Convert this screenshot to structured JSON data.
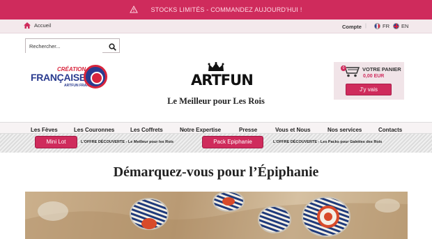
{
  "promo": {
    "icon": "warning-triangle-icon",
    "text": "STOCKS LIMITÉS - COMMANDEZ AUJOURD'HUI !"
  },
  "top_nav": {
    "home_label": "Accueil",
    "account_label": "Compte",
    "languages": [
      {
        "code": "FR"
      },
      {
        "code": "EN"
      }
    ]
  },
  "search": {
    "placeholder": "Rechercher..."
  },
  "badge": {
    "line1": "CRÉATION",
    "line2": "FRANÇAISE",
    "line3": "ARTFUN FRANCE"
  },
  "logo": {
    "text": "ARTFUN"
  },
  "tagline": "Le Meilleur pour Les Rois",
  "cart": {
    "label": "VOTRE PANIER",
    "amount": "0,00 EUR",
    "button": "J'y vais",
    "count": "0"
  },
  "main_nav": [
    {
      "label": "Les Fèves",
      "has_dropdown": true
    },
    {
      "label": "Les Couronnes",
      "has_dropdown": true
    },
    {
      "label": "Les Coffrets",
      "has_dropdown": false
    },
    {
      "label": "Notre Expertise",
      "has_dropdown": true
    },
    {
      "label": "Presse",
      "has_dropdown": false
    },
    {
      "label": "Vous et Nous",
      "has_dropdown": false
    },
    {
      "label": "Nos services",
      "has_dropdown": false
    },
    {
      "label": "Contacts",
      "has_dropdown": false
    }
  ],
  "offers": [
    {
      "button": "Mini Lot",
      "text": "L'OFFRE DÉCOUVERTE - Le Meilleur pour les Rois"
    },
    {
      "button": "Pack Epiphanie",
      "text": "L'OFFRE DÉCOUVERTE - Les Packs pour Galettes des Rois"
    }
  ],
  "hero": {
    "title": "Démarquez-vous pour l’Épiphanie"
  },
  "colors": {
    "accent": "#cf2b5c",
    "navy": "#2a3b8f",
    "red": "#d8243c"
  }
}
